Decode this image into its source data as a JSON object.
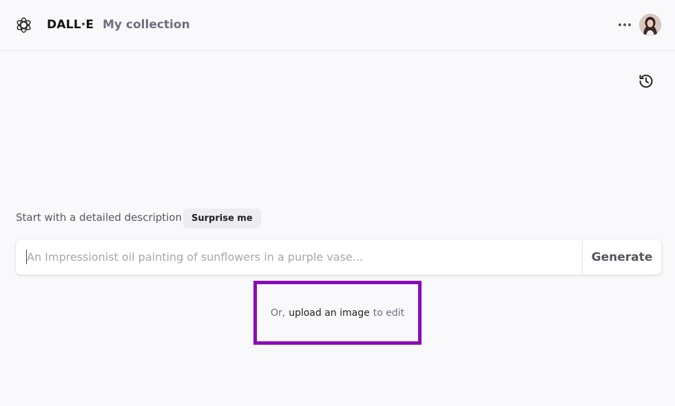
{
  "header": {
    "brand": "DALL·E",
    "nav_link": "My collection",
    "logo_icon": "openai-logo-icon",
    "more_icon": "more-horizontal-icon",
    "avatar_icon": "user-avatar"
  },
  "toolbar": {
    "history_icon": "history-icon"
  },
  "prompt": {
    "label": "Start with a detailed description",
    "surprise_label": "Surprise me",
    "placeholder": "An Impressionist oil painting of sunflowers in a purple vase...",
    "value": "",
    "generate_label": "Generate"
  },
  "upload": {
    "prefix": "Or,",
    "link": "upload an image",
    "suffix": "to edit"
  },
  "colors": {
    "background": "#f9f9fb",
    "highlight_border": "#8a0cb8",
    "surprise_bg": "#ececf1",
    "muted_text": "#6e6e80"
  }
}
